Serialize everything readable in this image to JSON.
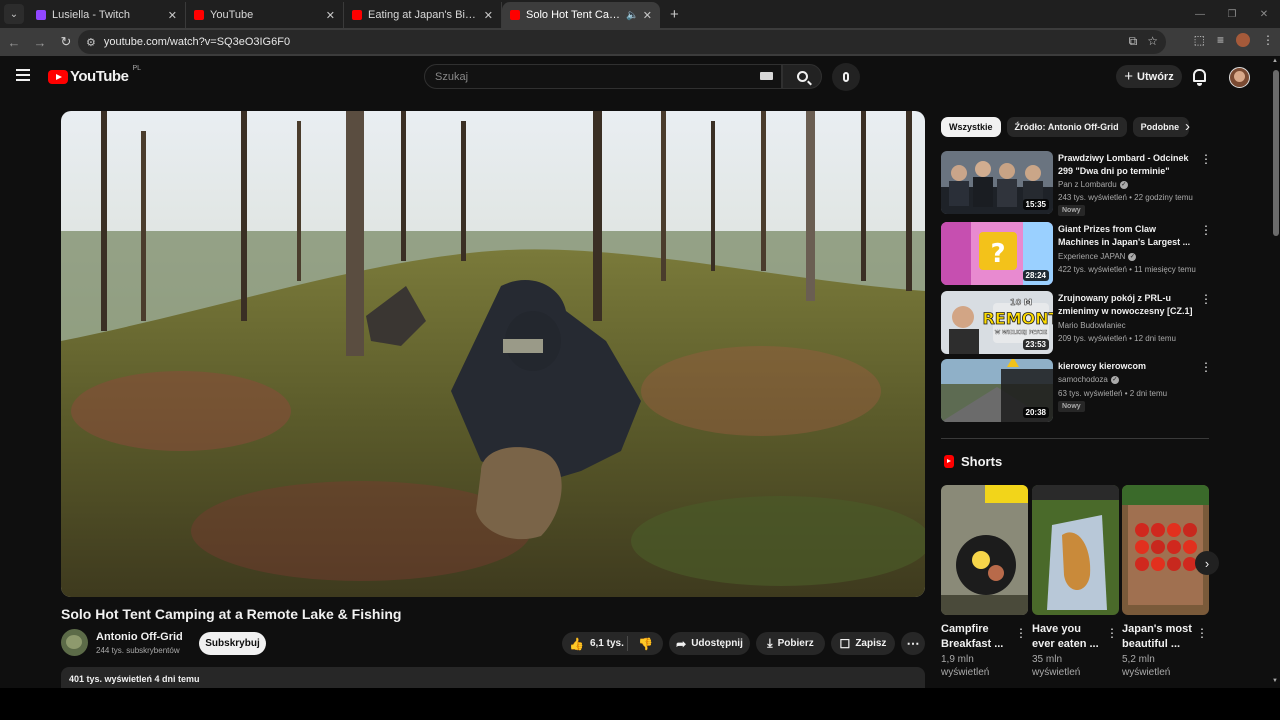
{
  "browser": {
    "tabs": [
      {
        "title": "Lusiella - Twitch",
        "favicon_color": "#9146ff"
      },
      {
        "title": "YouTube",
        "favicon_color": "#ff0000"
      },
      {
        "title": "Eating at Japan's Biggest Vendi",
        "favicon_color": "#ff0000"
      },
      {
        "title": "Solo Hot Tent Camping at a",
        "favicon_color": "#ff0000"
      }
    ],
    "url": "youtube.com/watch?v=SQ3eO3IG6F0"
  },
  "header": {
    "logo_text": "YouTube",
    "country_code": "PL",
    "search_placeholder": "Szukaj",
    "create_label": "Utwórz"
  },
  "video": {
    "title": "Solo Hot Tent Camping at a Remote Lake & Fishing",
    "channel_name": "Antonio Off-Grid",
    "subscribers": "244 tys. subskrybentów",
    "subscribe_label": "Subskrybuj",
    "likes": "6,1 tys.",
    "share_label": "Udostępnij",
    "download_label": "Pobierz",
    "save_label": "Zapisz",
    "views_date": "401 tys. wyświetleń  4 dni temu"
  },
  "sidebar": {
    "chips": [
      "Wszystkie",
      "Źródło: Antonio Off-Grid",
      "Podobne"
    ],
    "recommendations": [
      {
        "title": "Prawdziwy Lombard - Odcinek 299 \"Dwa dni po terminie\"",
        "channel": "Pan z Lombardu",
        "meta": "243 tys. wyświetleń • 22 godziny temu",
        "duration": "15:35",
        "badge": "Nowy"
      },
      {
        "title": "Giant Prizes from Claw Machines in Japan's Largest ...",
        "channel": "Experience JAPAN",
        "meta": "422 tys. wyświetleń • 11 miesięcy temu",
        "duration": "28:24",
        "badge": ""
      },
      {
        "title": "Zrujnowany pokój z PRL-u zmienimy w nowoczesny [CZ.1]",
        "channel": "Mario Budowlaniec",
        "meta": "209 tys. wyświetleń • 12 dni temu",
        "duration": "23:53",
        "badge": ""
      },
      {
        "title": "kierowcy kierowcom",
        "channel": "samochodoza",
        "meta": "63 tys. wyświetleń • 2 dni temu",
        "duration": "20:38",
        "badge": "Nowy"
      }
    ],
    "thumb_text": {
      "remont_top": "10 M",
      "remont_main": "REMONT",
      "remont_sub": "W WIELKIEJ PŁYCIE"
    },
    "shorts_heading": "Shorts",
    "shorts": [
      {
        "title": "Campfire Breakfast ...",
        "views": "1,9 mln wyświetleń"
      },
      {
        "title": "Have you ever eaten ...",
        "views": "35 mln wyświetleń"
      },
      {
        "title": "Japan's most beautiful ...",
        "views": "5,2 mln wyświetleń"
      }
    ]
  }
}
